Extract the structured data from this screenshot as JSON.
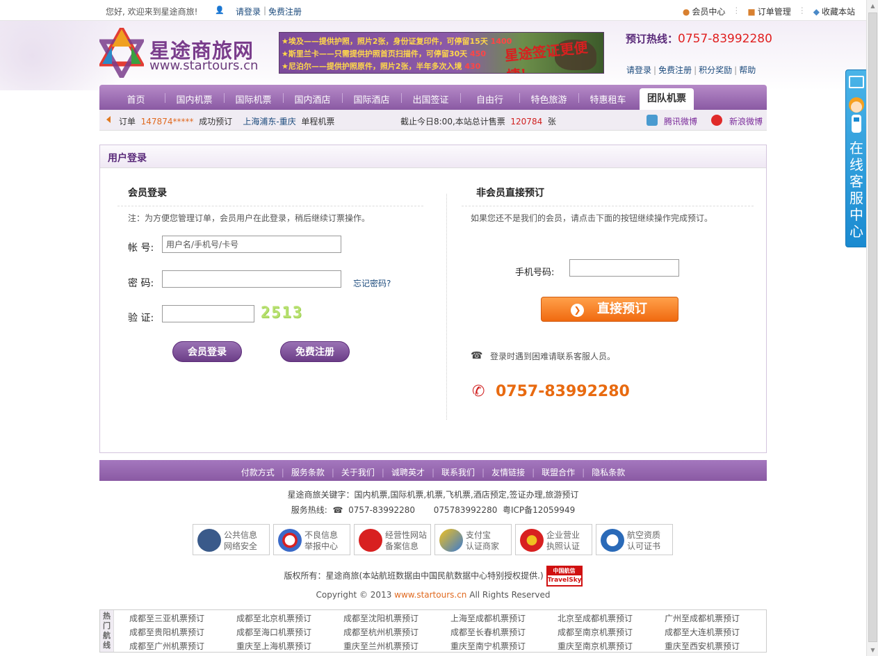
{
  "topbar": {
    "welcome": "您好, 欢迎来到星途商旅!",
    "login": "请登录",
    "register": "免费注册",
    "member_center": "会员中心",
    "order_manage": "订单管理",
    "favorite": "收藏本站"
  },
  "logo": {
    "name": "星途商旅网",
    "url": "www.startours.cn"
  },
  "banner": {
    "line1": "★埃及——提供护照，照片2张，身份证复印件，可停留15天",
    "price1": "1400",
    "line2": "★斯里兰卡——只需提供护照首页扫描件，可停留30天",
    "price2": "450",
    "line3": "★尼泊尔——提供护照原件，照片2张，半年多次入境",
    "price3": "430",
    "slogan": "星途签证更便捷!"
  },
  "header": {
    "hotline_label": "预订热线：",
    "hotline_number": "0757-83992280",
    "links": [
      "请登录",
      "免费注册",
      "积分奖励",
      "帮助"
    ]
  },
  "nav": {
    "items": [
      "首页",
      "国内机票",
      "国际机票",
      "国内酒店",
      "国际酒店",
      "出国签证",
      "自由行",
      "特色旅游",
      "特惠租车"
    ],
    "active": "团队机票"
  },
  "ticker": {
    "order_label": "订单",
    "order_number": "147874*****",
    "success": "成功预订",
    "route": "上海浦东-重庆",
    "type": "单程机票",
    "stats_prefix": "截止今日8:00,本站总计售票",
    "stats_count": "120784",
    "stats_unit": "张",
    "tencent_weibo": "腾讯微博",
    "sina_weibo": "新浪微博"
  },
  "login_panel": {
    "title": "用户登录",
    "member": {
      "heading": "会员登录",
      "note": "注：为方便您管理订单，会员用户在此登录，稍后继续订票操作。",
      "account_label": "帐 号:",
      "account_placeholder": "用户名/手机号/卡号",
      "password_label": "密 码:",
      "forgot": "忘记密码?",
      "verify_label": "验 证:",
      "captcha": "2513",
      "login_btn": "会员登录",
      "register_btn": "免费注册"
    },
    "guest": {
      "heading": "非会员直接预订",
      "note": "如果您还不是我们的会员，请点击下面的按钮继续操作完成预订。",
      "mobile_label": "手机号码:",
      "book_btn": "直接预订",
      "contact_note": "登录时遇到困难请联系客服人员。",
      "phone": "0757-83992280"
    }
  },
  "footer": {
    "nav": [
      "付款方式",
      "服务条款",
      "关于我们",
      "诚聘英才",
      "联系我们",
      "友情链接",
      "联盟合作",
      "隐私条款"
    ],
    "keywords": "星途商旅关键字：国内机票,国际机票,机票,飞机票,酒店预定,签证办理,旅游预订",
    "service_label": "服务热线:",
    "service_phone1": "0757-83992280",
    "service_phone2": "075783992280",
    "icp": "粤ICP备12059949",
    "badges": [
      {
        "line1": "公共信息",
        "line2": "网络安全"
      },
      {
        "line1": "不良信息",
        "line2": "举报中心"
      },
      {
        "line1": "经营性网站",
        "line2": "备案信息"
      },
      {
        "line1": "支付宝",
        "line2": "认证商家"
      },
      {
        "line1": "企业营业",
        "line2": "执照认证"
      },
      {
        "line1": "航空资质",
        "line2": "认可证书"
      }
    ],
    "copyright_prefix": "版权所有：星途商旅(本站航班数据由中国民航数据中心特别授权提供.)",
    "travelsky_top": "中国航信",
    "travelsky_bottom": "TravelSky",
    "copyright_line_pre": "Copyright © 2013 ",
    "copyright_link": "www.startours.cn",
    "copyright_line_post": " All Rights Reserved"
  },
  "hot_routes": {
    "label": "热门航线",
    "rows": [
      [
        "成都至三亚机票预订",
        "成都至北京机票预订",
        "成都至沈阳机票预订",
        "上海至成都机票预订",
        "北京至成都机票预订",
        "广州至成都机票预订"
      ],
      [
        "成都至贵阳机票预订",
        "成都至海口机票预订",
        "成都至杭州机票预订",
        "成都至长春机票预订",
        "成都至南京机票预订",
        "成都至大连机票预订"
      ],
      [
        "成都至广州机票预订",
        "重庆至上海机票预订",
        "重庆至兰州机票预订",
        "重庆至南宁机票预订",
        "重庆至南京机票预订",
        "重庆至西安机票预订"
      ]
    ]
  },
  "side_service": {
    "text": "在线客服中心"
  },
  "colors": {
    "brand_purple": "#8a5aa3",
    "accent_orange": "#f06a10",
    "link_blue": "#1b4a7c"
  }
}
